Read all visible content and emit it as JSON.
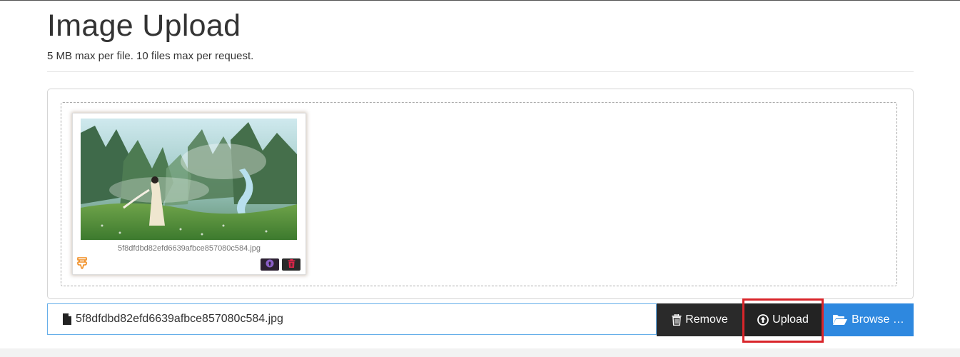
{
  "header": {
    "title": "Image Upload",
    "subtitle": "5 MB max per file. 10 files max per request."
  },
  "preview": {
    "filename": "5f8dfdbd82efd6639afbce857080c584.jpg",
    "image_description_icon": "fantasy-landscape-image",
    "drag_icon": "drag-handle-icon",
    "upload_icon": "upload-circle-icon",
    "delete_icon": "trash-icon"
  },
  "file_input": {
    "value": "5f8dfdbd82efd6639afbce857080c584.jpg",
    "icon": "file-icon"
  },
  "actions": {
    "remove_label": "Remove",
    "upload_label": "Upload",
    "browse_label": "Browse …"
  },
  "colors": {
    "browse_bg": "#2e88df",
    "dark_button_bg": "#2a2a2a",
    "highlight": "#d9252a",
    "input_border": "#66afe9",
    "delete_icon": "#e0244a",
    "drag_icon": "#f08a1c"
  }
}
